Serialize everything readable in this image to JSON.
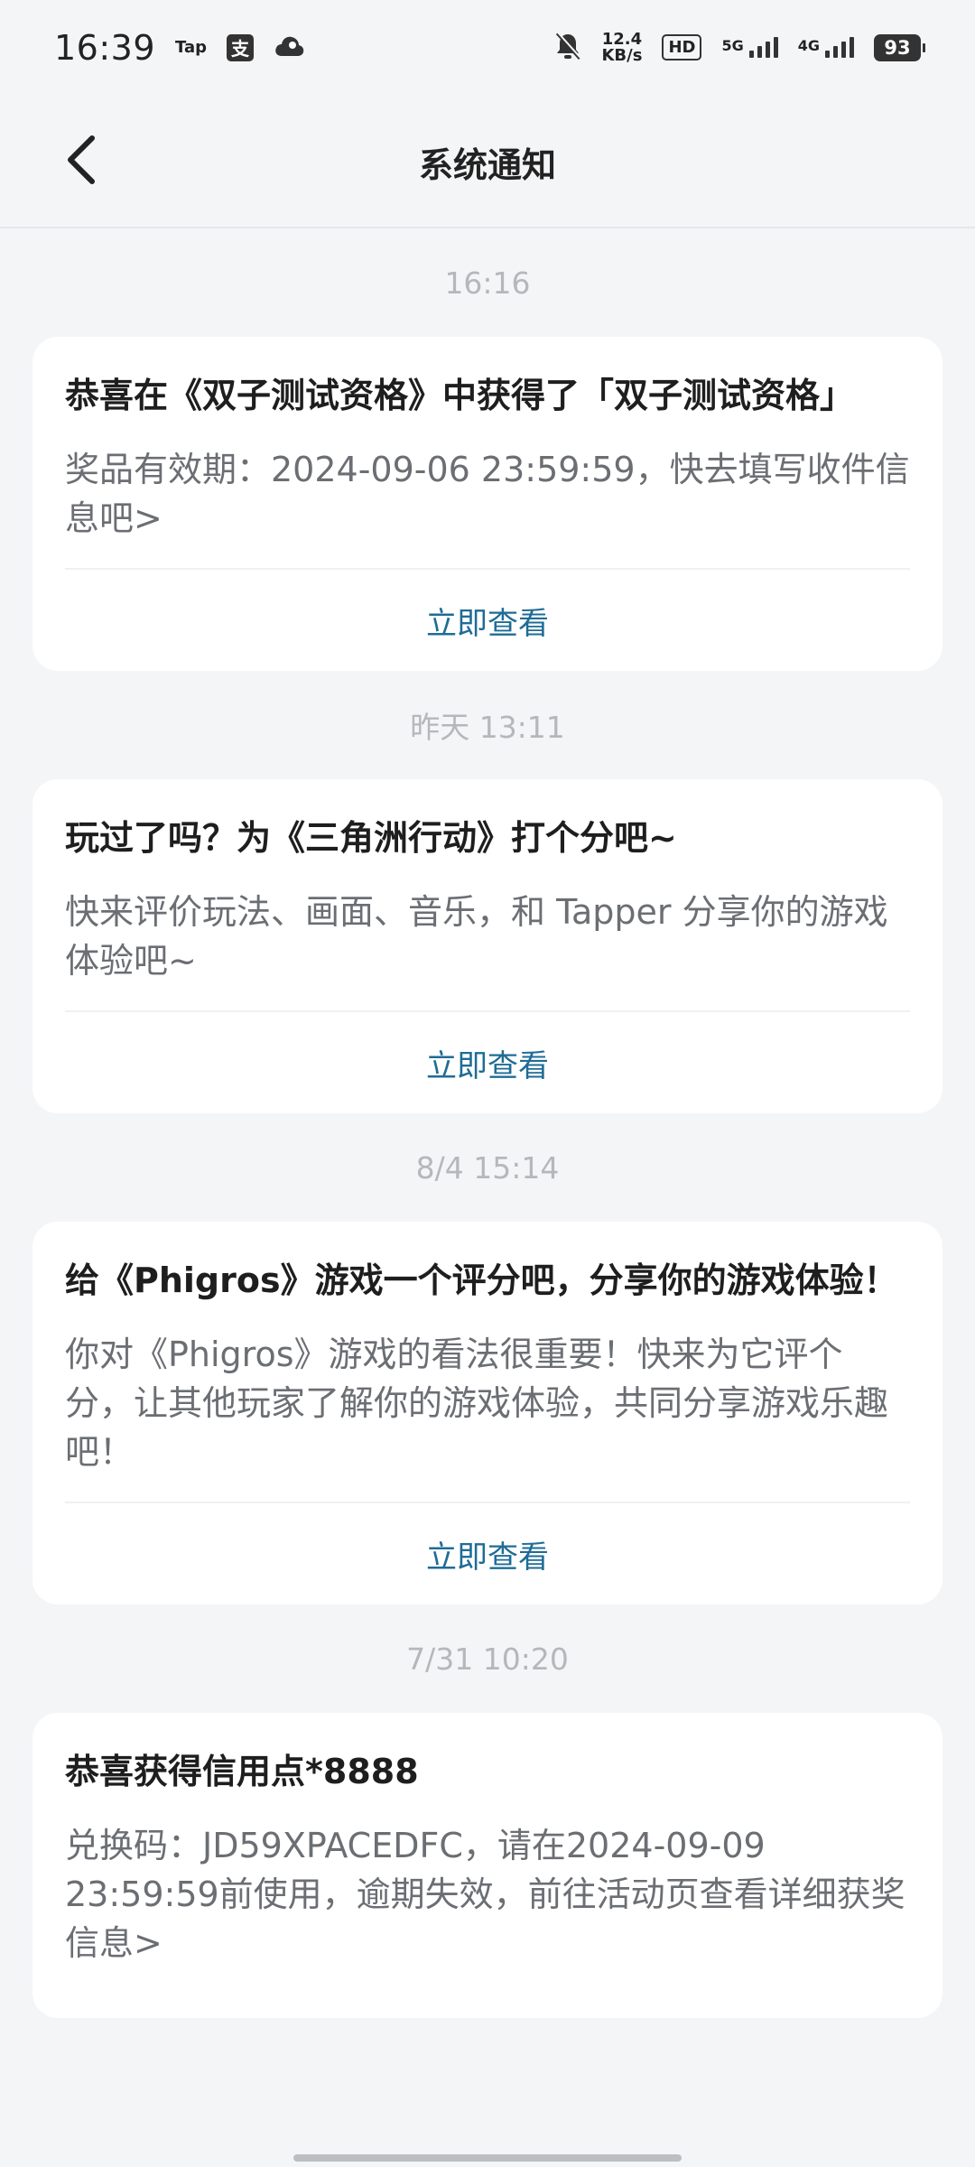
{
  "status_bar": {
    "time": "16:39",
    "app_icons": [
      "Tap",
      "支",
      "cloud-icon"
    ],
    "mute_icon": "bell-off-icon",
    "net_speed_value": "12.4",
    "net_speed_unit": "KB/s",
    "hd_label": "HD",
    "sig1_label": "5G",
    "sig2_label": "4G",
    "battery": "93"
  },
  "nav": {
    "title": "系统通知",
    "back_icon": "chevron-left-icon"
  },
  "messages": [
    {
      "timestamp": "16:16",
      "title": "恭喜在《双子测试资格》中获得了「双子测试资格」",
      "body": "奖品有效期：2024-09-06 23:59:59，快去填写收件信息吧>",
      "action": "立即查看"
    },
    {
      "timestamp": "昨天  13:11",
      "title": "玩过了吗？为《三角洲行动》打个分吧~",
      "body": "快来评价玩法、画面、音乐，和 Tapper 分享你的游戏体验吧~",
      "action": "立即查看"
    },
    {
      "timestamp": "8/4  15:14",
      "title": "给《Phigros》游戏一个评分吧，分享你的游戏体验！",
      "body": "你对《Phigros》游戏的看法很重要！快来为它评个分，让其他玩家了解你的游戏体验，共同分享游戏乐趣吧！",
      "action": "立即查看"
    },
    {
      "timestamp": "7/31  10:20",
      "title": "恭喜获得信用点*8888",
      "body": "兑换码：JD59XPACEDFC，请在2024-09-09 23:59:59前使用，逾期失效，前往活动页查看详细获奖信息>"
    }
  ],
  "colors": {
    "background": "#f4f5f7",
    "card": "#ffffff",
    "action_link": "#1f6c96",
    "timestamp": "#b5b7bb"
  }
}
